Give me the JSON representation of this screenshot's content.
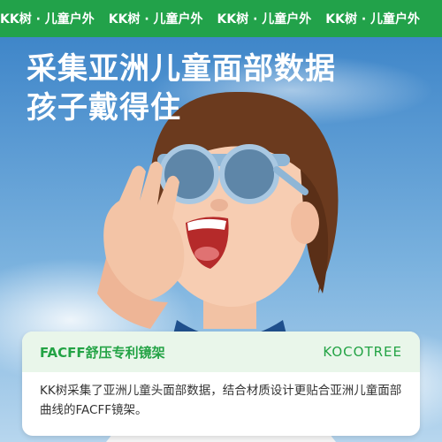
{
  "banner": {
    "items": [
      "KK树 · 儿童户外",
      "KK树 · 儿童户外",
      "KK树 · 儿童户外",
      "KK树 · 儿童户外"
    ],
    "color": "#22a24a"
  },
  "headline": {
    "line1": "采集亚洲儿童面部数据",
    "line2": "孩子戴得住"
  },
  "card": {
    "title": "FACFF舒压专利镜架",
    "brand": "KOCOTREE",
    "body": "KK树采集了亚洲儿童头面部数据，结合材质设计更贴合亚洲儿童面部曲线的FACFF镜架。",
    "accent": "#23a345"
  }
}
